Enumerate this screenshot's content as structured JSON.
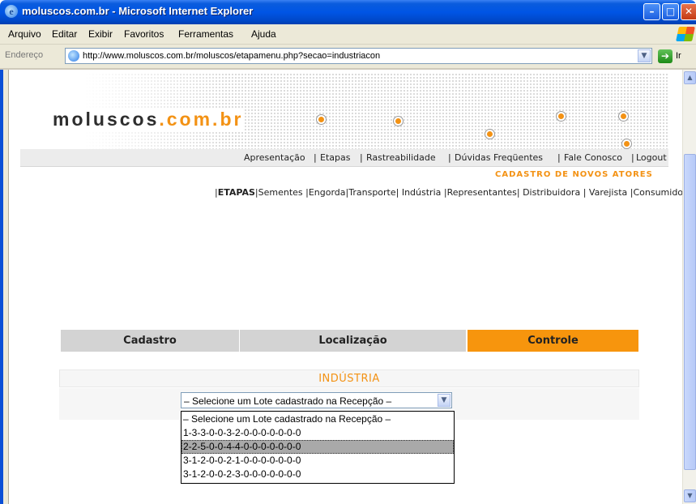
{
  "window": {
    "title": "moluscos.com.br - Microsoft Internet Explorer",
    "minimize": "–",
    "maximize": "□",
    "close": "✕"
  },
  "menu": {
    "items": [
      "Arquivo",
      "Editar",
      "Exibir",
      "Favoritos",
      "Ferramentas",
      "Ajuda"
    ]
  },
  "address": {
    "label": "Endereço",
    "url": "http://www.moluscos.com.br/moluscos/etapamenu.php?secao=industriacon",
    "go_label": "Ir",
    "dropdown_icon": "▼",
    "go_icon": "➔"
  },
  "site": {
    "logo_main": "moluscos",
    "logo_accent": ".com.br",
    "nav": [
      "Apresentação",
      "Etapas",
      "Rastreabilidade",
      "Dúvidas Freqüentes",
      "Fale Conosco",
      "Logout"
    ],
    "cadastro_title": "CADASTRO DE NOVOS ATORES",
    "stages_first": "ETAPAS",
    "stages": [
      "Sementes",
      "Engorda",
      "Transporte",
      "Indústria",
      "Representantes",
      "Distribuidora",
      "Varejista",
      "Consumidor"
    ],
    "accent_color": "#f39214"
  },
  "tabs": {
    "cadastro": "Cadastro",
    "localizacao": "Localização",
    "controle": "Controle",
    "active": "Controle"
  },
  "section": {
    "title": "INDÚSTRIA",
    "select_value": "– Selecione um Lote cadastrado na Recepção –",
    "options": [
      "– Selecione um Lote cadastrado na Recepção –",
      "1-3-3-0-0-3-2-0-0-0-0-0-0-0",
      "2-2-5-0-0-4-4-0-0-0-0-0-0-0",
      "3-1-2-0-0-2-1-0-0-0-0-0-0-0",
      "3-1-2-0-0-2-3-0-0-0-0-0-0-0"
    ],
    "highlighted_index": 2
  },
  "scrollbar": {
    "up": "▲",
    "down": "▼"
  }
}
